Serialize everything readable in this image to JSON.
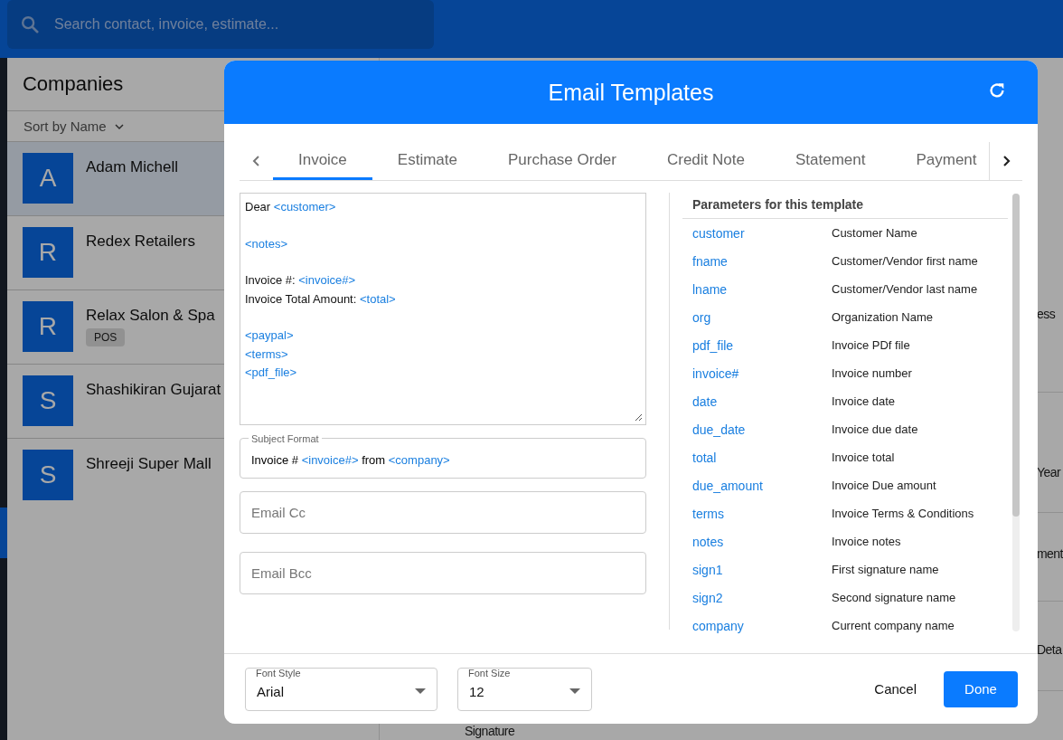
{
  "search": {
    "placeholder": "Search contact, invoice, estimate..."
  },
  "companies": {
    "title": "Companies",
    "sort": "Sort by Name",
    "items": [
      {
        "initial": "A",
        "name": "Adam Michell",
        "selected": true
      },
      {
        "initial": "R",
        "name": "Redex Retailers",
        "selected": false
      },
      {
        "initial": "R",
        "name": "Relax Salon & Spa",
        "tag": "POS",
        "selected": false
      },
      {
        "initial": "S",
        "name": "Shashikiran Gujarat",
        "selected": false
      },
      {
        "initial": "S",
        "name": "Shreeji Super Mall",
        "selected": false
      }
    ]
  },
  "background_fragments": [
    {
      "text": "ess"
    },
    {
      "text": "Year"
    },
    {
      "text": "ment"
    },
    {
      "text": "Deta"
    },
    {
      "text": "Signature"
    }
  ],
  "dialog": {
    "title": "Email Templates",
    "tabs": [
      {
        "label": "Invoice",
        "selected": true
      },
      {
        "label": "Estimate",
        "selected": false
      },
      {
        "label": "Purchase Order",
        "selected": false
      },
      {
        "label": "Credit Note",
        "selected": false
      },
      {
        "label": "Statement",
        "selected": false
      },
      {
        "label": "Payment",
        "selected": false
      }
    ],
    "body": [
      [
        [
          {
            "kind": "text",
            "text": "Dear "
          },
          {
            "kind": "param",
            "text": "<customer>"
          }
        ]
      ],
      [
        [
          {
            "kind": "param",
            "text": "<notes>"
          }
        ]
      ],
      [
        [
          {
            "kind": "text",
            "text": "Invoice #: "
          },
          {
            "kind": "param",
            "text": "<invoice#>"
          }
        ],
        [
          {
            "kind": "text",
            "text": "Invoice Total Amount: "
          },
          {
            "kind": "param",
            "text": "<total>"
          }
        ]
      ],
      [
        [
          {
            "kind": "param",
            "text": "<paypal>"
          }
        ],
        [
          {
            "kind": "param",
            "text": "<terms>"
          }
        ],
        [
          {
            "kind": "param",
            "text": "<pdf_file>"
          }
        ]
      ]
    ],
    "subject": {
      "label": "Subject Format",
      "segments": [
        {
          "kind": "text",
          "text": "Invoice # "
        },
        {
          "kind": "param",
          "text": "<invoice#>"
        },
        {
          "kind": "text",
          "text": " from "
        },
        {
          "kind": "param",
          "text": "<company>"
        }
      ]
    },
    "cc": {
      "placeholder": "Email Cc"
    },
    "bcc": {
      "placeholder": "Email Bcc"
    },
    "parameters_title": "Parameters for this template",
    "parameters": [
      {
        "name": "customer",
        "description": "Customer Name"
      },
      {
        "name": "fname",
        "description": "Customer/Vendor first name"
      },
      {
        "name": "lname",
        "description": "Customer/Vendor last name"
      },
      {
        "name": "org",
        "description": "Organization Name"
      },
      {
        "name": "pdf_file",
        "description": "Invoice PDf file"
      },
      {
        "name": "invoice#",
        "description": "Invoice number"
      },
      {
        "name": "date",
        "description": "Invoice date"
      },
      {
        "name": "due_date",
        "description": "Invoice due date"
      },
      {
        "name": "total",
        "description": "Invoice total"
      },
      {
        "name": "due_amount",
        "description": "Invoice Due amount"
      },
      {
        "name": "terms",
        "description": "Invoice Terms & Conditions"
      },
      {
        "name": "notes",
        "description": "Invoice notes"
      },
      {
        "name": "sign1",
        "description": "First signature name"
      },
      {
        "name": "sign2",
        "description": "Second signature name"
      },
      {
        "name": "company",
        "description": "Current company name"
      }
    ],
    "font_style": {
      "label": "Font Style",
      "value": "Arial"
    },
    "font_size": {
      "label": "Font Size",
      "value": "12"
    },
    "buttons": [
      {
        "kind": "text",
        "label": "Cancel"
      },
      {
        "kind": "primary",
        "label": "Done"
      }
    ]
  }
}
